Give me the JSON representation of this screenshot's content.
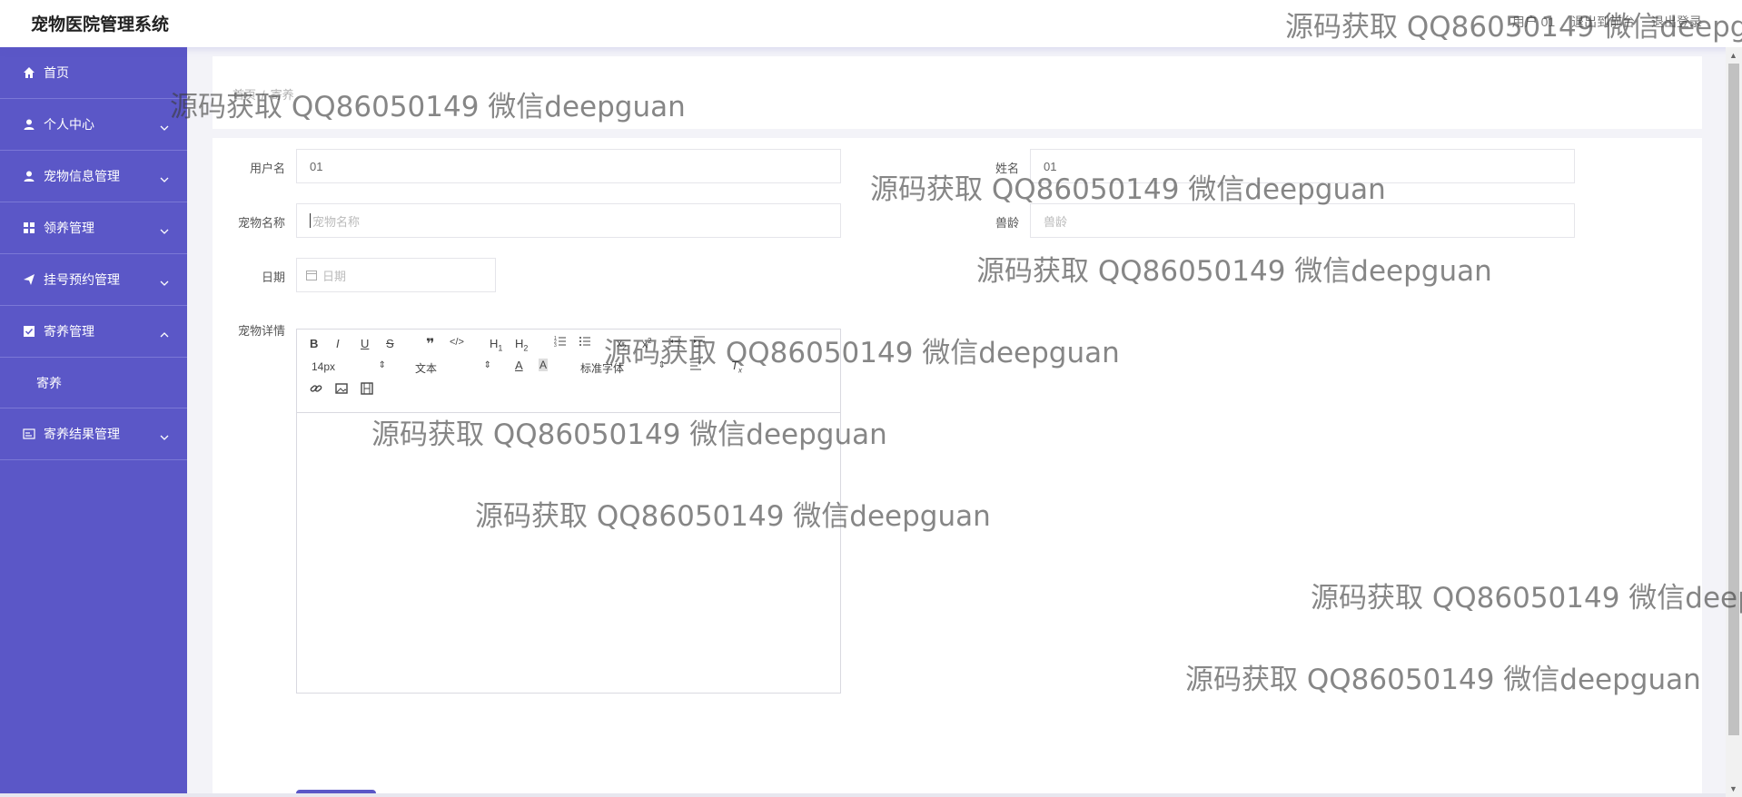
{
  "header": {
    "title": "宠物医院管理系统",
    "user_text": "用户 01",
    "switch_text": "退出到前台",
    "logout_text": "退出登录"
  },
  "sidebar": {
    "items": [
      {
        "label": "首页",
        "icon": "home-icon"
      },
      {
        "label": "个人中心",
        "icon": "user-icon"
      },
      {
        "label": "宠物信息管理",
        "icon": "user-icon"
      },
      {
        "label": "领养管理",
        "icon": "grid-icon"
      },
      {
        "label": "挂号预约管理",
        "icon": "send-icon"
      },
      {
        "label": "寄养管理",
        "icon": "checkbox-icon"
      },
      {
        "label": "寄养结果管理",
        "icon": "card-icon"
      }
    ],
    "sub_item": "寄养"
  },
  "breadcrumb": {
    "home": "首页",
    "separator": "/",
    "current": "寄养"
  },
  "form": {
    "username_label": "用户名",
    "username_value": "01",
    "name_label": "姓名",
    "name_value": "01",
    "pet_name_label": "宠物名称",
    "pet_name_placeholder": "宠物名称",
    "age_label": "兽龄",
    "age_placeholder": "兽龄",
    "date_label": "日期",
    "date_placeholder": "日期",
    "detail_label": "宠物详情"
  },
  "editor": {
    "font_size": "14px",
    "text_type": "文本",
    "font_family": "标准字体"
  },
  "watermark": "源码获取 QQ86050149 微信deepguan",
  "colors": {
    "sidebar": "#5b57c7",
    "accent": "#5b57c7"
  }
}
